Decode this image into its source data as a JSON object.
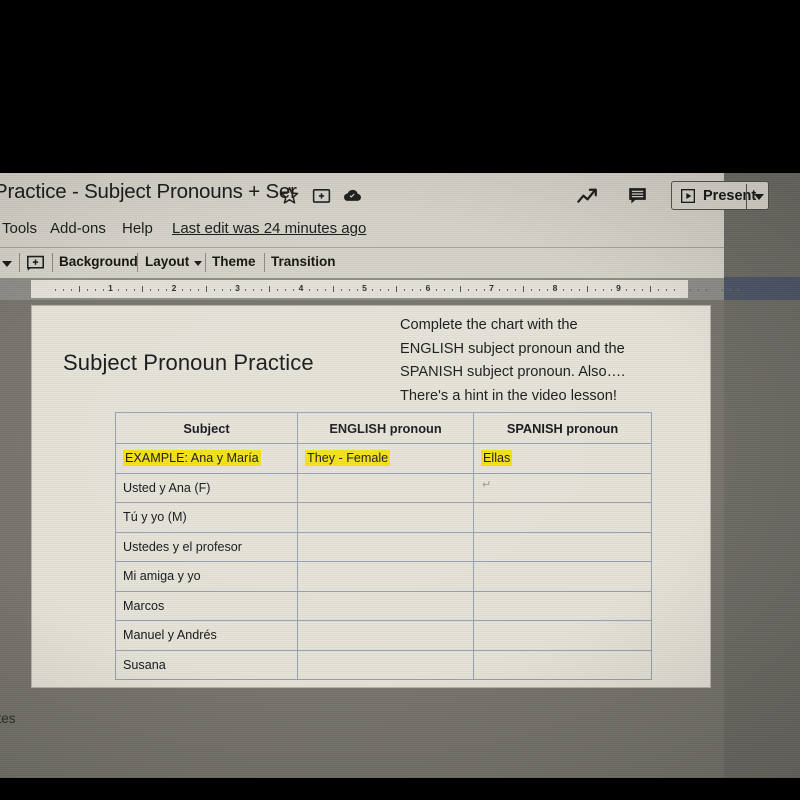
{
  "app": {
    "document_title": "Practice - Subject Pronouns + Ser",
    "last_edit": "Last edit was 24 minutes ago",
    "icons": {
      "star": "star-icon",
      "move_to_folder": "move-to-folder-icon",
      "cloud_saved": "cloud-saved-icon",
      "activity": "activity-trend-icon",
      "comment": "comment-icon",
      "new_slide": "new-slide-icon"
    }
  },
  "menu": {
    "items": [
      {
        "label": "Tools"
      },
      {
        "label": "Add-ons"
      },
      {
        "label": "Help"
      }
    ]
  },
  "present": {
    "label": "Present",
    "caret": "▾"
  },
  "toolbar": {
    "background_label": "Background",
    "layout_label": "Layout",
    "theme_label": "Theme",
    "transition_label": "Transition"
  },
  "ruler": {
    "numbers": [
      "1",
      "2",
      "3",
      "4",
      "5",
      "6",
      "7",
      "8",
      "9"
    ]
  },
  "slide": {
    "title": "Subject Pronoun Practice",
    "instructions": [
      "Complete the chart with the",
      "ENGLISH subject pronoun and the",
      "SPANISH subject pronoun. Also….",
      "There's a hint in the video lesson!"
    ],
    "table": {
      "headers": [
        "Subject",
        "ENGLISH pronoun",
        "SPANISH pronoun"
      ],
      "rows": [
        {
          "subject": "EXAMPLE: Ana y María",
          "english": "They - Female",
          "spanish": "Ellas",
          "highlighted": true
        },
        {
          "subject": "Usted y Ana (F)",
          "english": "",
          "spanish": "",
          "highlighted": false
        },
        {
          "subject": "Tú y yo (M)",
          "english": "",
          "spanish": "",
          "highlighted": false
        },
        {
          "subject": "Ustedes y el profesor",
          "english": "",
          "spanish": "",
          "highlighted": false
        },
        {
          "subject": "Mi amiga y yo",
          "english": "",
          "spanish": "",
          "highlighted": false
        },
        {
          "subject": "Marcos",
          "english": "",
          "spanish": "",
          "highlighted": false
        },
        {
          "subject": "Manuel y Andrés",
          "english": "",
          "spanish": "",
          "highlighted": false
        },
        {
          "subject": "Susana",
          "english": "",
          "spanish": "",
          "highlighted": false
        }
      ]
    },
    "artifact_glyph": "↵"
  },
  "notes": {
    "label": "otes"
  },
  "colors": {
    "highlight": "#f5e212",
    "chrome": "#d5d2c9",
    "workspace": "#77756d",
    "slide_background": "#e6e3d8",
    "table_border": "#9a9fb4",
    "scrollbar": "#4e5668"
  }
}
